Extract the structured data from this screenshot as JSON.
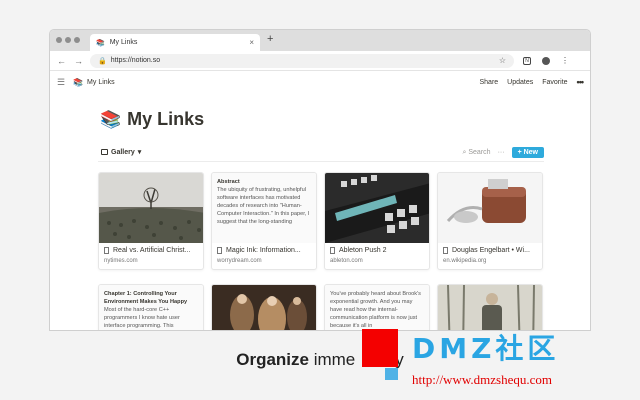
{
  "browser": {
    "tab_title": "My Links",
    "tab_close": "×",
    "new_tab": "+",
    "url": "https://notion.so",
    "nav": {
      "back": "←",
      "forward": "→",
      "reload": "C"
    }
  },
  "notion_header": {
    "breadcrumb": "My Links",
    "breadcrumb_icon": "📚",
    "menu_icon": "☰",
    "actions": {
      "share": "Share",
      "updates": "Updates",
      "favorite": "Favorite",
      "more": "•••"
    }
  },
  "page": {
    "icon": "📚",
    "title": "My Links",
    "view_name": "Gallery",
    "search_label": "Search",
    "more_label": "···",
    "new_label": "+ New"
  },
  "cards": [
    {
      "title": "Real vs. Artificial Christ...",
      "domain": "nytimes.com",
      "cover": "image-tree-farm"
    },
    {
      "title": "Magic Ink: Information...",
      "domain": "worrydream.com",
      "cover": "text",
      "cover_heading": "Abstract",
      "cover_text": "The ubiquity of frustrating, unhelpful software interfaces has motivated decades of research into \"Human-Computer Interaction.\" In this paper, I suggest that the long-standing"
    },
    {
      "title": "Ableton Push 2",
      "domain": "ableton.com",
      "cover": "image-push-controller"
    },
    {
      "title": "Douglas Engelbart • Wi...",
      "domain": "en.wikipedia.org",
      "cover": "image-mouse"
    },
    {
      "cover": "text",
      "cover_heading": "Chapter 1: Controlling Your Environment Makes You Happy",
      "cover_text": "Most of the hard-core C++ programmers I know hate user interface programming. This"
    },
    {
      "cover": "image-painting"
    },
    {
      "cover": "text",
      "cover_heading": "",
      "cover_text": "You've probably heard about Brook's exponential growth. And you may have read how the internal-communication platform is now just because it's all in"
    },
    {
      "cover": "image-forest-person"
    }
  ],
  "caption": {
    "bold": "Organize",
    "rest": " imme",
    "tail": "y"
  },
  "watermark": {
    "text": "DMZ社区",
    "url": "http://www.dmzshequ.com"
  },
  "colors": {
    "accent": "#2eaadc",
    "watermark_blue": "#2aa5e3",
    "watermark_red": "#f40000"
  }
}
